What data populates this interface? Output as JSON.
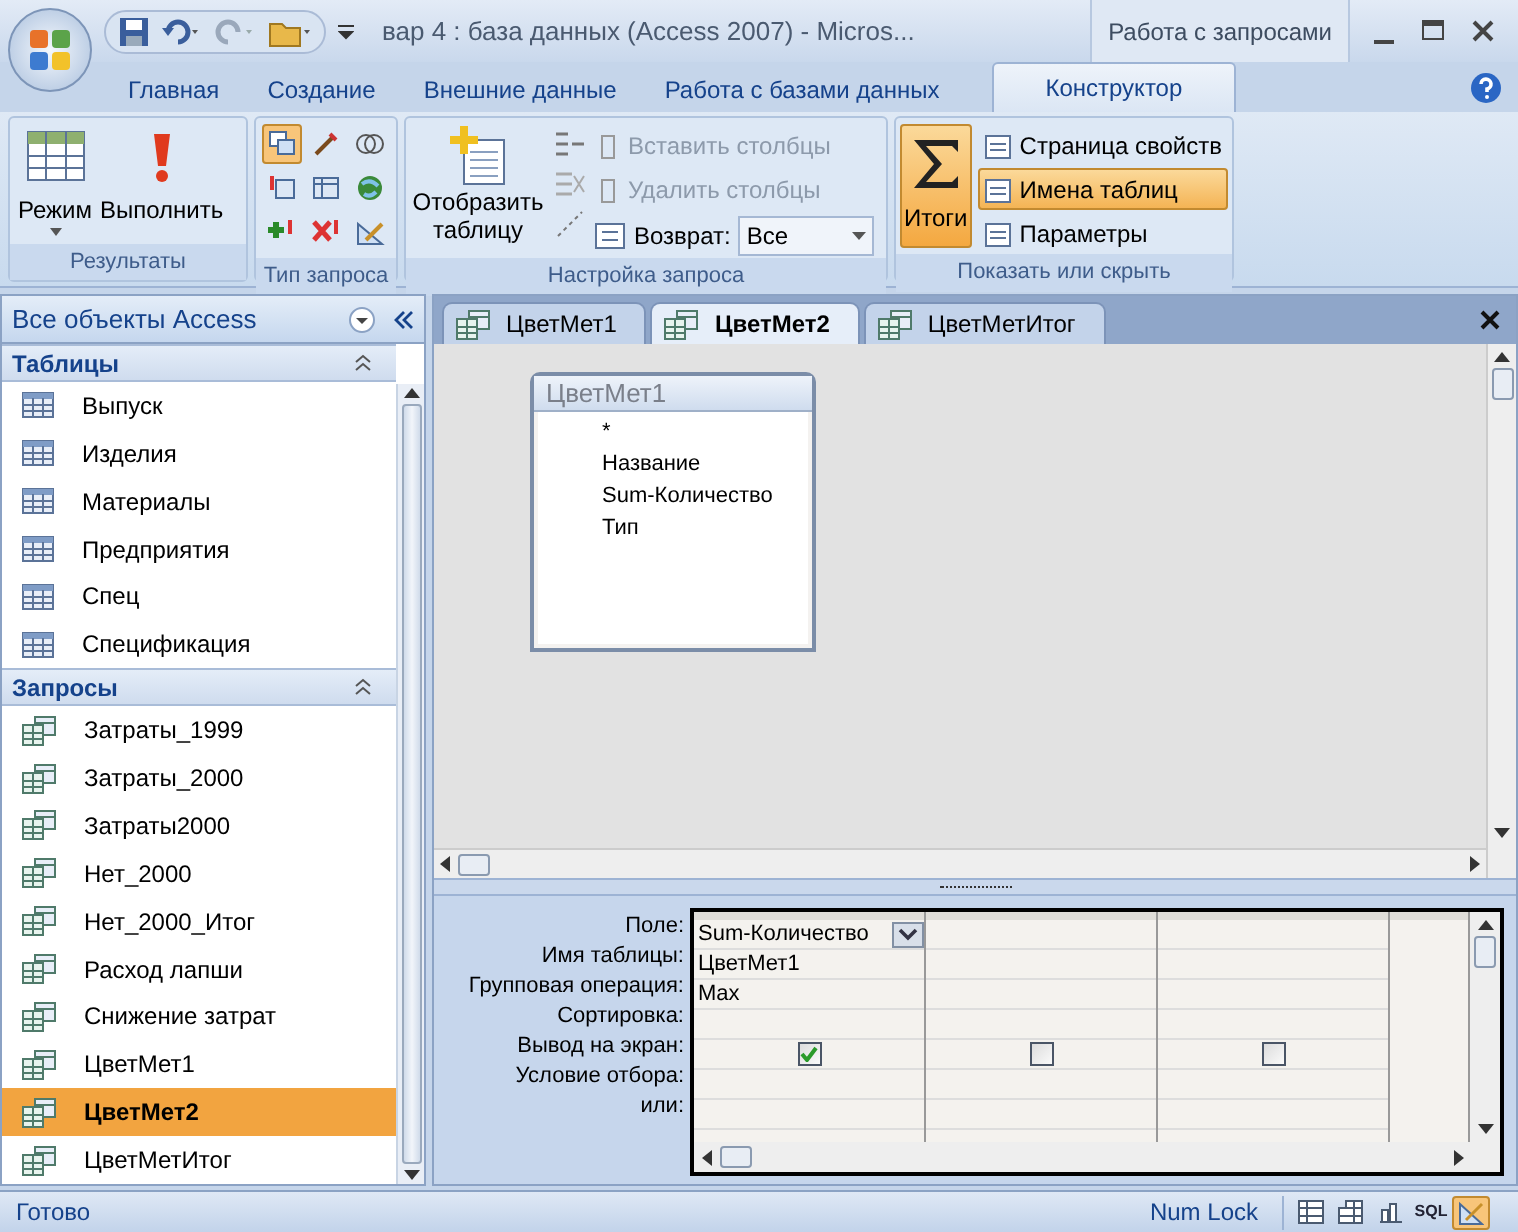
{
  "window": {
    "title": "вар 4 : база данных (Access 2007) - Micros...",
    "context_tab": "Работа с запросами"
  },
  "ribbon_tabs": [
    {
      "label": "Главная",
      "selected": false
    },
    {
      "label": "Создание",
      "selected": false
    },
    {
      "label": "Внешние данные",
      "selected": false
    },
    {
      "label": "Работа с базами данных",
      "selected": false
    },
    {
      "label": "Конструктор",
      "selected": true
    }
  ],
  "results_group": {
    "label": "Результаты",
    "buttons": [
      "Режим",
      "Выполнить"
    ]
  },
  "query_type_group": {
    "label": "Тип запроса",
    "buttons": [
      {
        "selected": true
      },
      {
        "selected": false
      },
      {
        "selected": false
      },
      {
        "selected": false
      },
      {
        "selected": false
      },
      {
        "selected": false
      },
      {
        "selected": false
      },
      {
        "selected": false
      },
      {
        "selected": false
      }
    ]
  },
  "setup_group": {
    "label": "Настройка запроса",
    "show_table": "Отобразить таблицу",
    "commands": [
      {
        "label": "Вставить столбцы",
        "disabled": true
      },
      {
        "label": "Удалить столбцы",
        "disabled": true
      }
    ],
    "return_label": "Возврат:",
    "return_value": "Все"
  },
  "show_group": {
    "label": "Показать или скрыть",
    "totals": {
      "label": "Итоги",
      "selected": true
    },
    "commands": [
      {
        "label": "Страница свойств",
        "selected": false
      },
      {
        "label": "Имена таблиц",
        "selected": true
      },
      {
        "label": "Параметры",
        "selected": false
      }
    ]
  },
  "nav": {
    "title": "Все объекты Access",
    "groups": [
      {
        "title": "Таблицы",
        "kind": "table",
        "items": [
          {
            "label": "Выпуск",
            "selected": false
          },
          {
            "label": "Изделия",
            "selected": false
          },
          {
            "label": "Материалы",
            "selected": false
          },
          {
            "label": "Предприятия",
            "selected": false
          },
          {
            "label": "Спец",
            "selected": false
          },
          {
            "label": "Спецификация",
            "selected": false
          }
        ]
      },
      {
        "title": "Запросы",
        "kind": "query",
        "items": [
          {
            "label": "Затраты_1999",
            "selected": false
          },
          {
            "label": "Затраты_2000",
            "selected": false
          },
          {
            "label": "Затраты2000",
            "selected": false
          },
          {
            "label": "Нет_2000",
            "selected": false
          },
          {
            "label": "Нет_2000_Итог",
            "selected": false
          },
          {
            "label": "Расход лапши",
            "selected": false
          },
          {
            "label": "Снижение затрат",
            "selected": false
          },
          {
            "label": "ЦветМет1",
            "selected": false
          },
          {
            "label": "ЦветМет2",
            "selected": true
          },
          {
            "label": "ЦветМетИтог",
            "selected": false
          }
        ]
      }
    ]
  },
  "doc_tabs": [
    {
      "label": "ЦветМет1",
      "selected": false
    },
    {
      "label": "ЦветМет2",
      "selected": true
    },
    {
      "label": "ЦветМетИтог",
      "selected": false
    }
  ],
  "field_list": {
    "title": "ЦветМет1",
    "fields": [
      "*",
      "Название",
      "Sum-Количество",
      "Тип"
    ]
  },
  "grid": {
    "row_labels": [
      "Поле:",
      "Имя таблицы:",
      "Групповая операция:",
      "Сортировка:",
      "Вывод на экран:",
      "Условие отбора:",
      "или:"
    ],
    "columns": [
      {
        "field": "Sum-Количество",
        "table": "ЦветМет1",
        "total": "Max",
        "show": true
      },
      {
        "show": false
      },
      {
        "show": false
      }
    ]
  },
  "status_bar": {
    "left": "Готово",
    "num_lock": "Num Lock",
    "views": [
      {
        "kind": "datasheet",
        "selected": false
      },
      {
        "kind": "pivot",
        "selected": false
      },
      {
        "kind": "chart",
        "selected": false
      },
      {
        "kind": "sql",
        "label": "SQL",
        "selected": false
      },
      {
        "kind": "design",
        "selected": true
      }
    ]
  }
}
